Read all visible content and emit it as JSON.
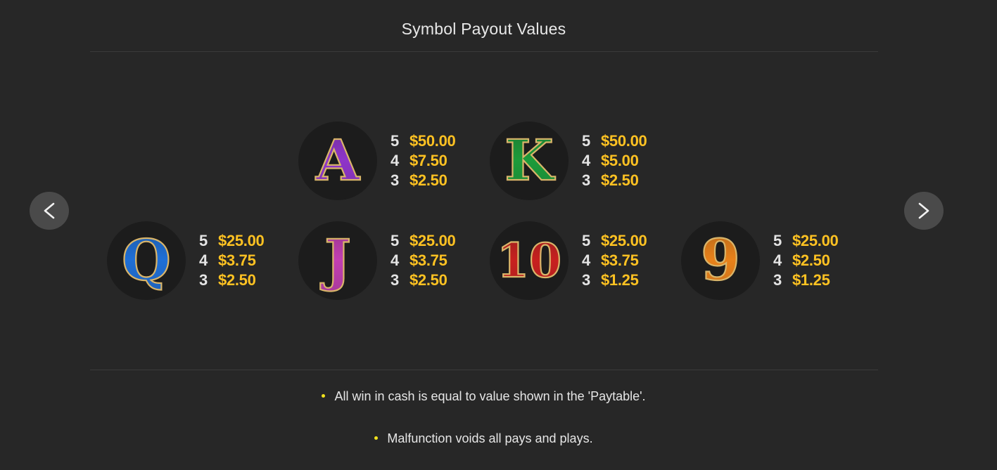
{
  "title": "Symbol Payout Values",
  "nav": {
    "prev_label": "<",
    "next_label": ">"
  },
  "colors": {
    "background": "#272727",
    "payout_value": "#ffc222",
    "bullet": "#f2e21d"
  },
  "symbols": [
    {
      "glyph": "A",
      "icon": "letter-a-purple-icon",
      "color": "#8e35c9",
      "pays": [
        {
          "count": "5",
          "value": "$50.00"
        },
        {
          "count": "4",
          "value": "$7.50"
        },
        {
          "count": "3",
          "value": "$2.50"
        }
      ]
    },
    {
      "glyph": "K",
      "icon": "letter-k-green-icon",
      "color": "#1c9b3a",
      "pays": [
        {
          "count": "5",
          "value": "$50.00"
        },
        {
          "count": "4",
          "value": "$5.00"
        },
        {
          "count": "3",
          "value": "$2.50"
        }
      ]
    },
    {
      "glyph": "Q",
      "icon": "letter-q-blue-icon",
      "color": "#1f6fd6",
      "pays": [
        {
          "count": "5",
          "value": "$25.00"
        },
        {
          "count": "4",
          "value": "$3.75"
        },
        {
          "count": "3",
          "value": "$2.50"
        }
      ]
    },
    {
      "glyph": "J",
      "icon": "letter-j-pink-icon",
      "color": "#c23fb2",
      "pays": [
        {
          "count": "5",
          "value": "$25.00"
        },
        {
          "count": "4",
          "value": "$3.75"
        },
        {
          "count": "3",
          "value": "$2.50"
        }
      ]
    },
    {
      "glyph": "10",
      "icon": "number-10-red-icon",
      "color": "#c8201f",
      "pays": [
        {
          "count": "5",
          "value": "$25.00"
        },
        {
          "count": "4",
          "value": "$3.75"
        },
        {
          "count": "3",
          "value": "$1.25"
        }
      ]
    },
    {
      "glyph": "9",
      "icon": "number-9-orange-icon",
      "color": "#e8811a",
      "pays": [
        {
          "count": "5",
          "value": "$25.00"
        },
        {
          "count": "4",
          "value": "$2.50"
        },
        {
          "count": "3",
          "value": "$1.25"
        }
      ]
    }
  ],
  "notes": [
    "All win in cash is equal to value shown in the 'Paytable'.",
    "Malfunction voids all pays and plays."
  ]
}
